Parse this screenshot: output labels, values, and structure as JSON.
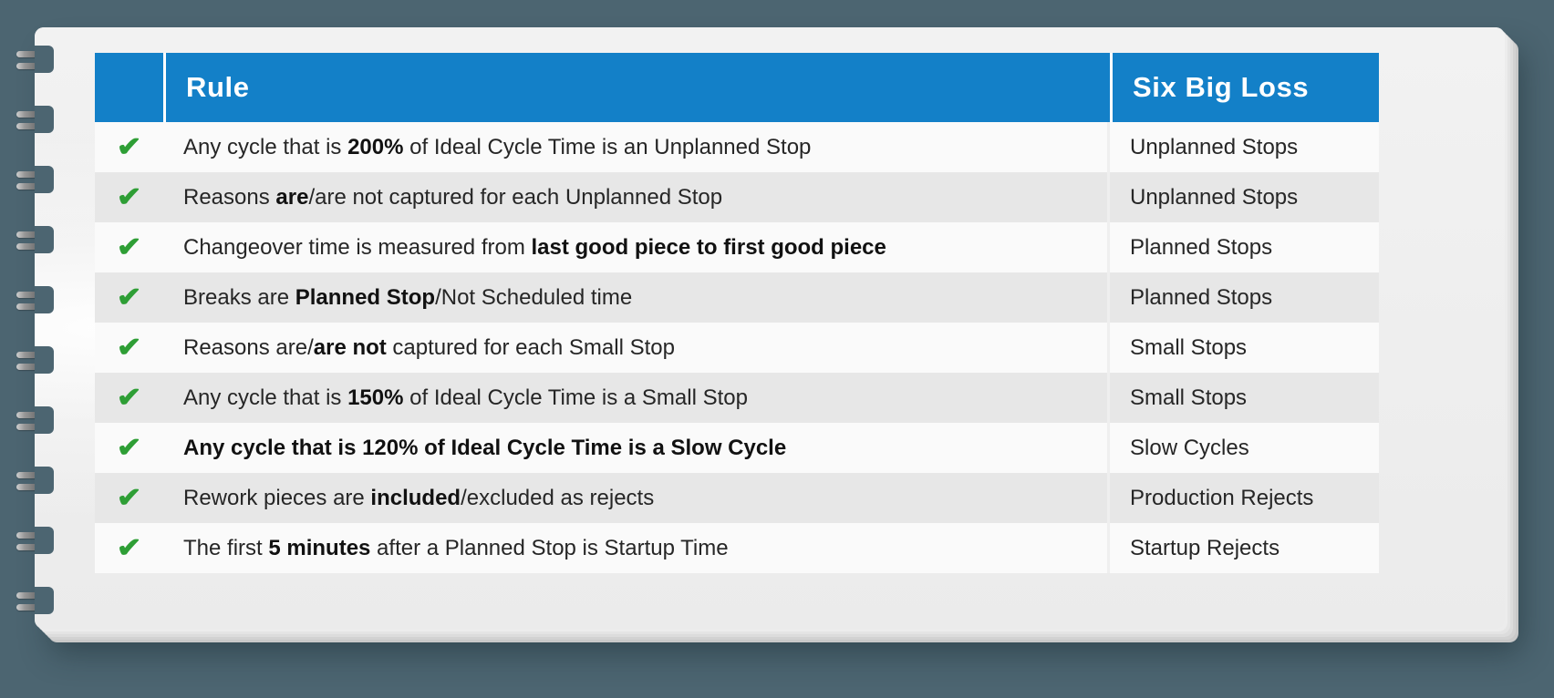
{
  "page": {
    "background_color": "#4c6571",
    "paper_color": "#efefef"
  },
  "colors": {
    "header_blue": "#1380c8",
    "check_green": "#2e9e35",
    "row_light": "#fafafa",
    "row_dark": "#e7e7e7",
    "text": "#262626"
  },
  "table": {
    "columns": [
      {
        "key": "check",
        "label": ""
      },
      {
        "key": "rule",
        "label": "Rule"
      },
      {
        "key": "loss",
        "label": "Six Big Loss"
      }
    ],
    "header": {
      "rule_label": "Rule",
      "loss_label": "Six Big Loss"
    },
    "check_glyph": "✔",
    "rows": [
      {
        "checked": true,
        "rule_plain": "Any cycle that is 200% of Ideal Cycle Time is an Unplanned Stop",
        "rule_parts": [
          {
            "text": "Any cycle that is ",
            "bold": false
          },
          {
            "text": "200%",
            "bold": true
          },
          {
            "text": " of Ideal Cycle Time is an Unplanned Stop",
            "bold": false
          }
        ],
        "loss": "Unplanned Stops",
        "emphasized": false,
        "shade": "light"
      },
      {
        "checked": true,
        "rule_plain": "Reasons are/are not captured for each Unplanned Stop",
        "rule_parts": [
          {
            "text": "Reasons ",
            "bold": false
          },
          {
            "text": "are",
            "bold": true
          },
          {
            "text": "/are not captured for each Unplanned Stop",
            "bold": false
          }
        ],
        "loss": "Unplanned Stops",
        "emphasized": false,
        "shade": "dark"
      },
      {
        "checked": true,
        "rule_plain": "Changeover time is measured from last good piece to first good piece",
        "rule_parts": [
          {
            "text": "Changeover time is measured from ",
            "bold": false
          },
          {
            "text": "last good piece to first good piece",
            "bold": true
          }
        ],
        "loss": "Planned Stops",
        "emphasized": false,
        "shade": "light"
      },
      {
        "checked": true,
        "rule_plain": "Breaks are Planned Stop/Not Scheduled time",
        "rule_parts": [
          {
            "text": "Breaks are ",
            "bold": false
          },
          {
            "text": "Planned Stop",
            "bold": true
          },
          {
            "text": "/Not Scheduled time",
            "bold": false
          }
        ],
        "loss": "Planned Stops",
        "emphasized": false,
        "shade": "dark"
      },
      {
        "checked": true,
        "rule_plain": "Reasons are/are not captured for each Small Stop",
        "rule_parts": [
          {
            "text": "Reasons are/",
            "bold": false
          },
          {
            "text": "are not",
            "bold": true
          },
          {
            "text": " captured for each Small Stop",
            "bold": false
          }
        ],
        "loss": "Small Stops",
        "emphasized": false,
        "shade": "light"
      },
      {
        "checked": true,
        "rule_plain": "Any cycle that is 150% of Ideal Cycle Time is a Small Stop",
        "rule_parts": [
          {
            "text": "Any cycle that is ",
            "bold": false
          },
          {
            "text": "150%",
            "bold": true
          },
          {
            "text": " of Ideal Cycle Time is a Small Stop",
            "bold": false
          }
        ],
        "loss": "Small Stops",
        "emphasized": false,
        "shade": "dark"
      },
      {
        "checked": true,
        "rule_plain": "Any cycle that is 120% of Ideal Cycle Time is a Slow Cycle",
        "rule_parts": [
          {
            "text": "Any cycle that is ",
            "bold": false
          },
          {
            "text": "120%",
            "bold": true
          },
          {
            "text": " of Ideal Cycle Time is a Slow Cycle",
            "bold": false
          }
        ],
        "loss": "Slow Cycles",
        "emphasized": true,
        "shade": "light"
      },
      {
        "checked": true,
        "rule_plain": "Rework pieces are included/excluded as rejects",
        "rule_parts": [
          {
            "text": "Rework pieces are ",
            "bold": false
          },
          {
            "text": "included",
            "bold": true
          },
          {
            "text": "/excluded as rejects",
            "bold": false
          }
        ],
        "loss": "Production Rejects",
        "emphasized": false,
        "shade": "dark"
      },
      {
        "checked": true,
        "rule_plain": "The first 5 minutes after a Planned Stop is Startup Time",
        "rule_parts": [
          {
            "text": "The first ",
            "bold": false
          },
          {
            "text": "5 minutes",
            "bold": true
          },
          {
            "text": " after a Planned Stop is Startup Time",
            "bold": false
          }
        ],
        "loss": "Startup Rejects",
        "emphasized": false,
        "shade": "light"
      }
    ]
  },
  "binding": {
    "ring_count": 10
  }
}
